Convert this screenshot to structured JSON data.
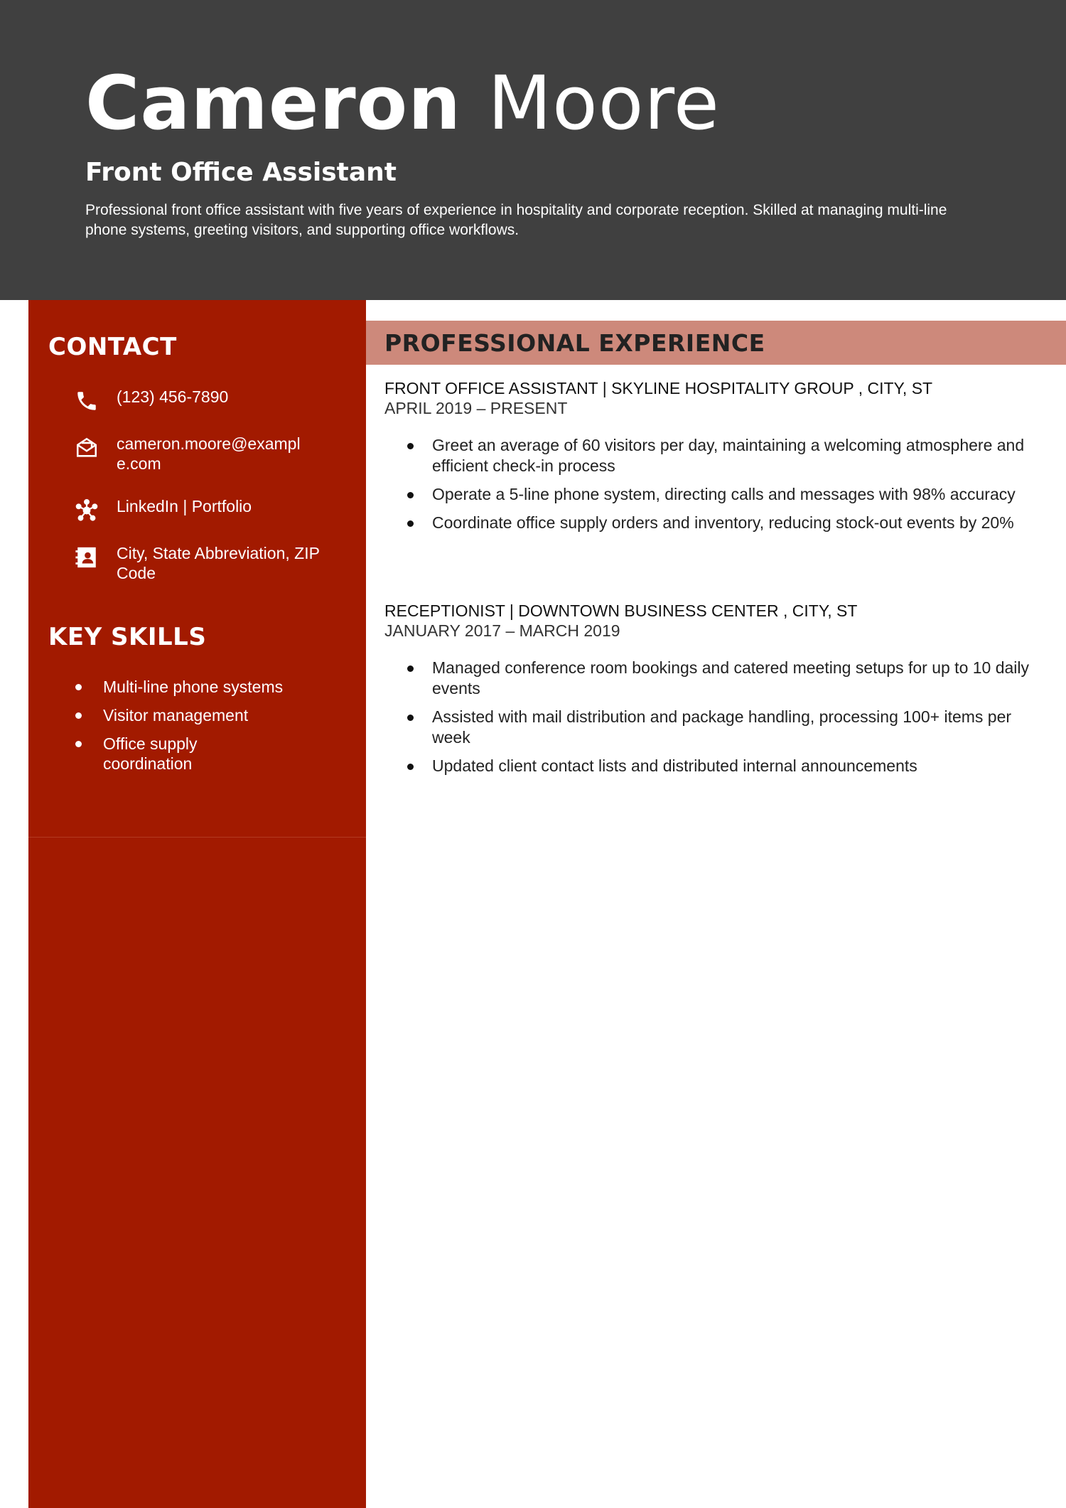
{
  "header": {
    "first_name": "Cameron",
    "last_name": "Moore",
    "job_title": "Front Office Assistant",
    "summary": "Professional front office assistant with five years of experience in hospitality and corporate reception. Skilled at managing multi-line phone systems, greeting visitors, and supporting office workflows."
  },
  "sidebar": {
    "contact_heading": "CONTACT",
    "contact": [
      {
        "icon": "phone-icon",
        "text": "(123) 456-7890"
      },
      {
        "icon": "envelope-icon",
        "text": "cameron.moore@exam​ple.com"
      },
      {
        "icon": "network-icon",
        "text": "LinkedIn | Portfolio"
      },
      {
        "icon": "address-card-icon",
        "text": "City, State Abbreviation, ZIP Code"
      }
    ],
    "skills_heading": "KEY SKILLS",
    "skills": [
      "Multi-line phone systems",
      "Visitor management",
      "Office supply coordination"
    ]
  },
  "experience": {
    "heading": "PROFESSIONAL EXPERIENCE",
    "jobs": [
      {
        "title": "FRONT OFFICE ASSISTANT  | SKYLINE HOSPITALITY GROUP , CITY, ST",
        "dates": "APRIL 2019 – PRESENT",
        "bullets": [
          "Greet an average of 60 visitors per day, maintaining a welcoming atmosphere and efficient check-in process",
          "Operate a 5-line phone system, directing calls and messages with 98% accuracy",
          "Coordinate office supply orders and inventory, reducing stock-out events by 20%"
        ]
      },
      {
        "title": "RECEPTIONIST  | DOWNTOWN BUSINESS CENTER , CITY, ST",
        "dates": "JANUARY 2017 – MARCH 2019",
        "bullets": [
          "Managed conference room bookings and catered meeting setups for up to 10 daily events",
          "Assisted with mail distribution and package handling, processing 100+ items per week",
          "Updated client contact lists and distributed internal announcements"
        ]
      }
    ]
  },
  "colors": {
    "header_bg": "#404040",
    "sidebar_bg": "#a21a00",
    "section_bar": "#cd897b"
  }
}
